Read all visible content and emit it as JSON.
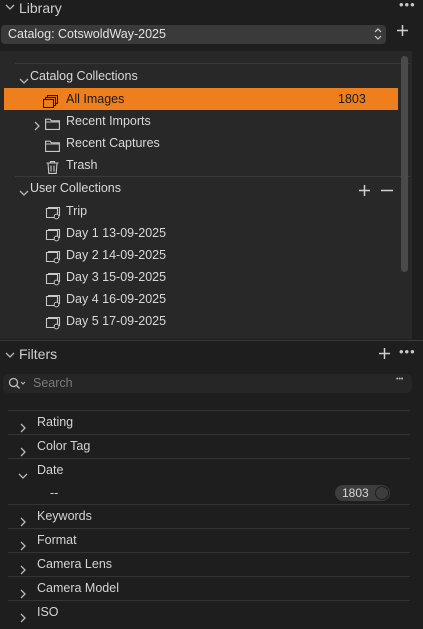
{
  "library": {
    "title": "Library",
    "catalog_select": "Catalog: CotswoldWay-2025",
    "catalog_collections_header": "Catalog Collections",
    "catalog_items": [
      {
        "label": "All Images",
        "count": "1803",
        "icon": "all-images-icon"
      },
      {
        "label": "Recent Imports",
        "icon": "folder-icon"
      },
      {
        "label": "Recent Captures",
        "icon": "folder-icon"
      },
      {
        "label": "Trash",
        "icon": "trash-icon"
      }
    ],
    "user_collections_header": "User Collections",
    "user_items": [
      {
        "label": "Trip"
      },
      {
        "label": "Day 1 13-09-2025"
      },
      {
        "label": "Day 2 14-09-2025"
      },
      {
        "label": "Day 3 15-09-2025"
      },
      {
        "label": "Day 4 16-09-2025"
      },
      {
        "label": "Day 5 17-09-2025"
      }
    ]
  },
  "filters": {
    "title": "Filters",
    "search_placeholder": "Search",
    "items": [
      {
        "label": "Rating"
      },
      {
        "label": "Color Tag"
      },
      {
        "label": "Date",
        "expanded": true,
        "value": "--",
        "count": "1803"
      },
      {
        "label": "Keywords"
      },
      {
        "label": "Format"
      },
      {
        "label": "Camera Lens"
      },
      {
        "label": "Camera Model"
      },
      {
        "label": "ISO"
      }
    ]
  },
  "colors": {
    "selection": "#ee7f1c",
    "background": "#1e1e1e",
    "panel": "#282828"
  }
}
